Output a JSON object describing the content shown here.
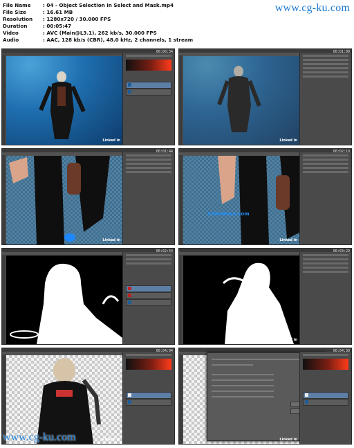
{
  "file_info": {
    "rows": [
      {
        "key": "File Name",
        "value": ":  04 - Object Selection in Select and Mask.mp4"
      },
      {
        "key": "File Size",
        "value": ":  16.61 MB"
      },
      {
        "key": "Resolution",
        "value": ":  1280x720 / 30.000 FPS"
      },
      {
        "key": "Duration",
        "value": ":  00:05:47"
      },
      {
        "key": "Video",
        "value": ":  AVC (Main@L3.1), 262 kb/s, 30.000 FPS"
      },
      {
        "key": "Audio",
        "value": ":  AAC, 128 kb/s (CBR), 48.0 kHz, 2 channels, 1 stream"
      }
    ]
  },
  "watermarks": {
    "top": "www.cg-ku.com",
    "bottom": "www.cg-ku.com",
    "mid": "©devdown.com"
  },
  "brand": "Linked in",
  "frames": [
    {
      "timestamp": "00:00:34",
      "canvas": "ocean"
    },
    {
      "timestamp": "00:01:09",
      "canvas": "ocean-faded"
    },
    {
      "timestamp": "00:01:44",
      "canvas": "closeup-checker"
    },
    {
      "timestamp": "00:02:19",
      "canvas": "closeup-blue"
    },
    {
      "timestamp": "00:02:54",
      "canvas": "mask"
    },
    {
      "timestamp": "00:03:29",
      "canvas": "mask"
    },
    {
      "timestamp": "00:04:04",
      "canvas": "diver-checker"
    },
    {
      "timestamp": "00:04:39",
      "canvas": "dialog"
    }
  ],
  "colors": {
    "accent": "#1d7bd0",
    "ps_panel": "#4a4a4a",
    "ps_bg": "#535353"
  }
}
